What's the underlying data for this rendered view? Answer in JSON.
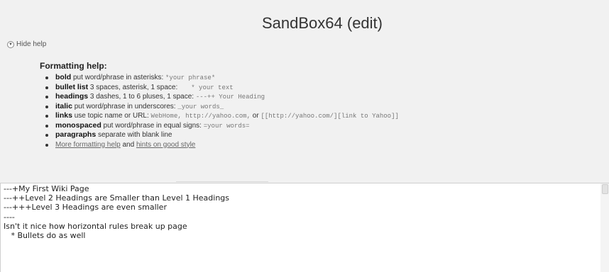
{
  "header": {
    "title": "SandBox64 (edit)"
  },
  "help": {
    "toggle_label": "Hide help",
    "heading": "Formatting help:",
    "items": [
      {
        "term": "bold",
        "text": " put word/phrase in asterisks: ",
        "code": "*your phrase*"
      },
      {
        "term": "bullet list",
        "text": " 3 spaces, asterisk, 1 space: ",
        "code": "   * your text"
      },
      {
        "term": "headings",
        "text": " 3 dashes, 1 to 6 pluses, 1 space: ",
        "code": "---++ Your Heading"
      },
      {
        "term": "italic",
        "text": " put word/phrase in underscores: ",
        "code": "_your words_"
      },
      {
        "term": "links",
        "text": " use topic name or URL: ",
        "code1": "WebHome, http://yahoo.com,",
        "or": " or ",
        "code2": "[[http://yahoo.com/][link to Yahoo]]"
      },
      {
        "term": "monospaced",
        "text": " put word/phrase in equal signs: ",
        "code": "=your words="
      },
      {
        "term": "paragraphs",
        "text": " separate with blank line"
      },
      {
        "link1": "More formatting help",
        "and": " and ",
        "link2": "hints on good style"
      }
    ]
  },
  "editor": {
    "content": "---+My First Wiki Page\n---++Level 2 Headings are Smaller than Level 1 Headings\n---+++Level 3 Headings are even smaller\n----\nIsn't it nice how horizontal rules break up page\n   * Bullets do as well"
  }
}
